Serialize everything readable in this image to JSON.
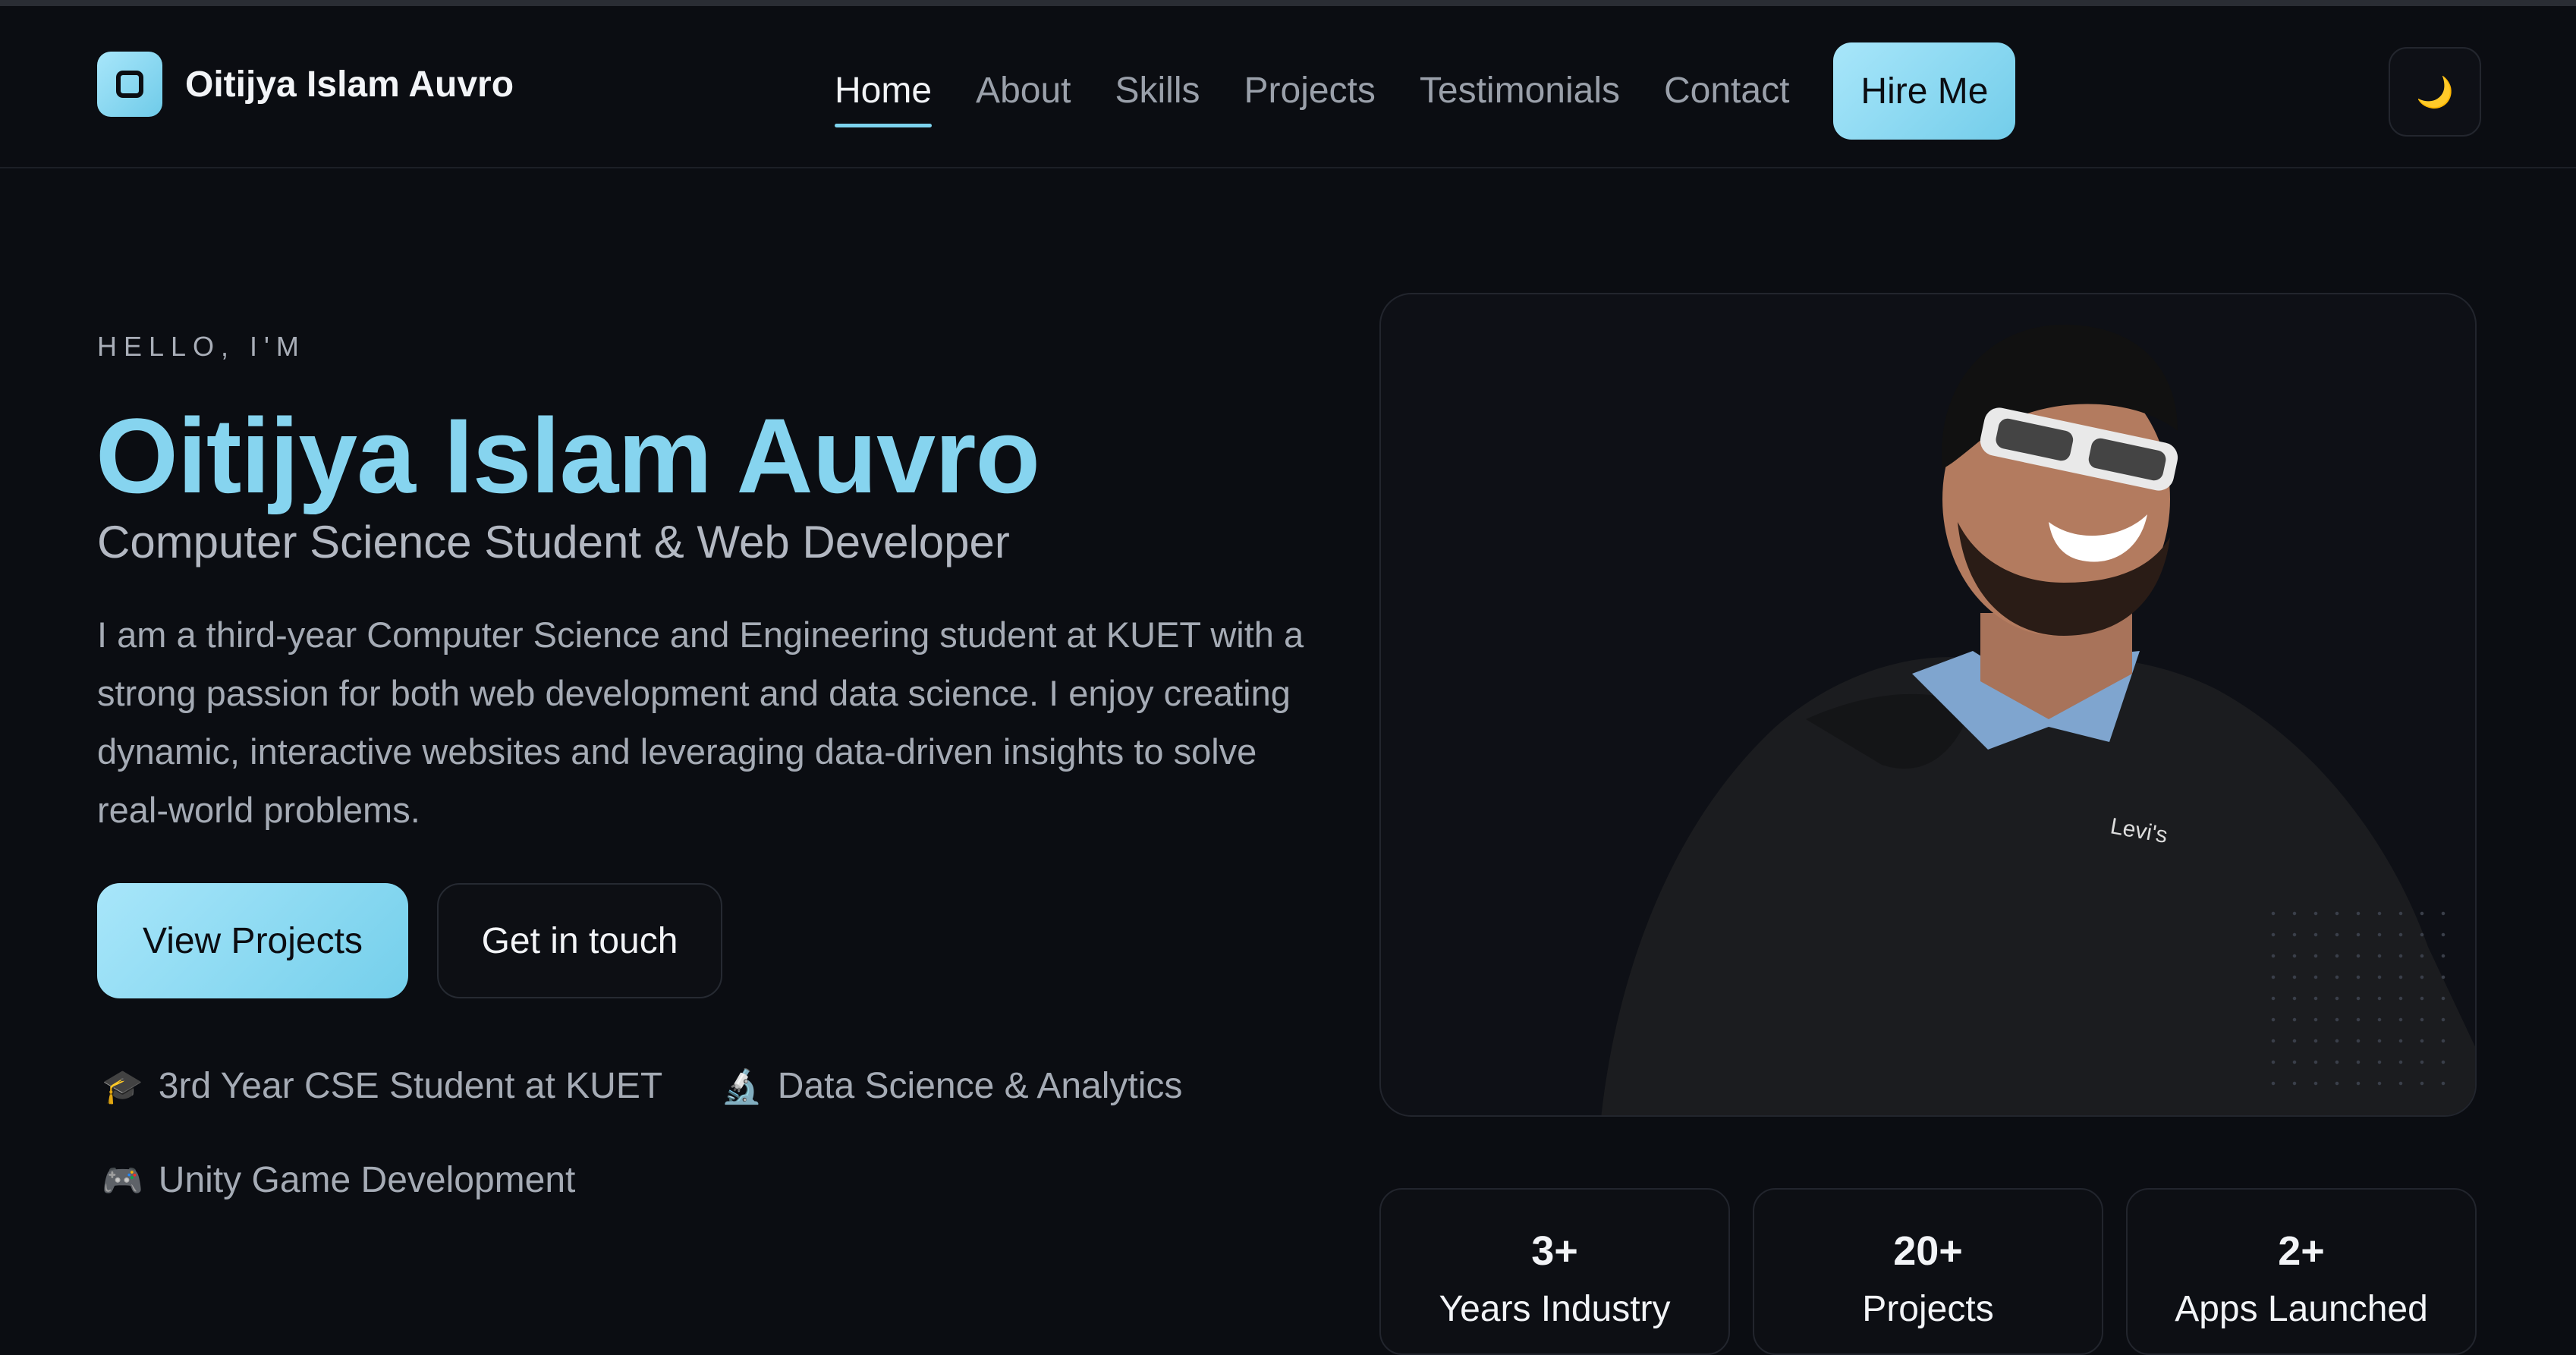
{
  "header": {
    "brand_name": "Oitijya Islam Auvro",
    "nav": [
      "Home",
      "About",
      "Skills",
      "Projects",
      "Testimonials",
      "Contact"
    ],
    "active_nav": "Home",
    "hire_label": "Hire Me",
    "theme_icon": "moon-icon"
  },
  "hero": {
    "eyebrow": "HELLO, I'M",
    "name": "Oitijya Islam Auvro",
    "role": "Computer Science Student & Web Developer",
    "bio": "I am a third-year Computer Science and Engineering student at KUET with a strong passion for both web development and data science. I enjoy creating dynamic, interactive websites and leveraging data-driven insights to solve real-world problems.",
    "primary_button": "View Projects",
    "secondary_button": "Get in touch",
    "tags": [
      {
        "icon": "graduation-cap-icon",
        "label": "3rd Year CSE Student at KUET"
      },
      {
        "icon": "microscope-icon",
        "label": "Data Science & Analytics"
      },
      {
        "icon": "gamepad-icon",
        "label": "Unity Game Development"
      }
    ]
  },
  "stats": [
    {
      "value": "3+",
      "label": "Years Industry"
    },
    {
      "value": "20+",
      "label": "Projects"
    },
    {
      "value": "2+",
      "label": "Apps Launched"
    }
  ],
  "colors": {
    "background": "#0b0d12",
    "accent": "#86d4ef",
    "button_gradient_start": "#a8e6fa",
    "button_gradient_end": "#74cfeb"
  }
}
